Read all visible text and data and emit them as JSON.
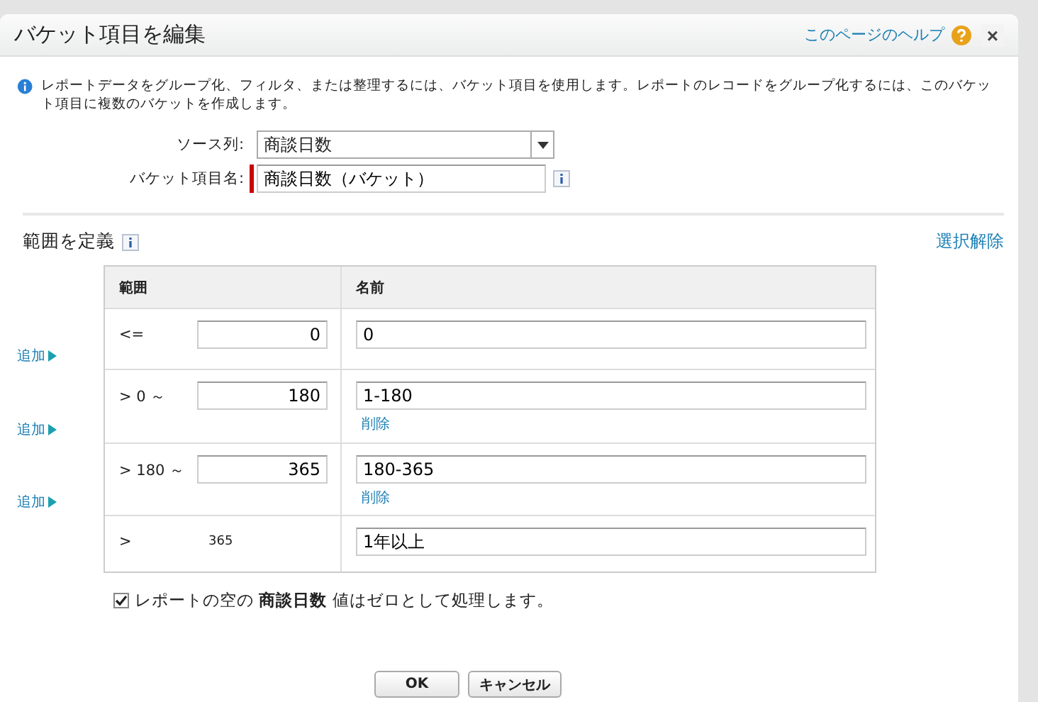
{
  "dialog": {
    "title": "バケット項目を編集",
    "help_link": "このページのヘルプ",
    "close": "×"
  },
  "info": "レポートデータをグループ化、フィルタ、または整理するには、バケット項目を使用します。レポートのレコードをグループ化するには、このバケット項目に複数のバケットを作成します。",
  "form": {
    "source_label": "ソース列:",
    "source_value": "商談日数",
    "name_label": "バケット項目名:",
    "name_value": "商談日数（バケット）",
    "name_required": true
  },
  "ranges": {
    "title": "範囲を定義",
    "clear_link": "選択解除",
    "columns": [
      "範囲",
      "名前"
    ],
    "rows": [
      {
        "operator": "<=",
        "value": "0",
        "kind": "input",
        "name": "0",
        "delete": null,
        "add_link": "追加"
      },
      {
        "operator": "> 0 ～",
        "value": "180",
        "kind": "input",
        "name": "1-180",
        "delete": "削除",
        "add_link": "追加"
      },
      {
        "operator": "> 180 ～",
        "value": "365",
        "kind": "input",
        "name": "180-365",
        "delete": "削除",
        "add_link": "追加"
      },
      {
        "operator": ">",
        "value": "365",
        "kind": "text",
        "name": "1年以上",
        "delete": null,
        "add_link": null
      }
    ]
  },
  "null_option": {
    "checked": true,
    "text": "レポートの空の **商談日数** 値はゼロとして処理します。"
  },
  "buttons": [
    "OK",
    "キャンセル"
  ]
}
